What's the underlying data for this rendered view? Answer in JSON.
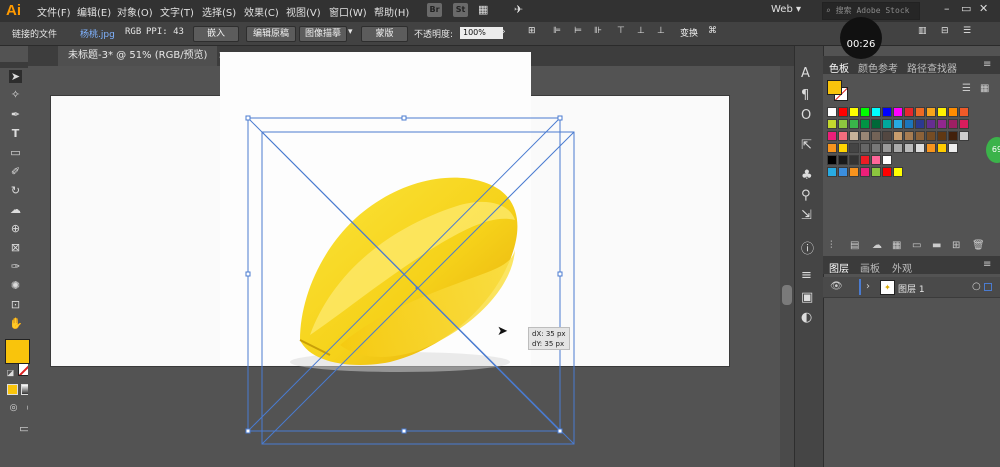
{
  "app": {
    "logo": "Ai",
    "menus": [
      "文件(F)",
      "编辑(E)",
      "对象(O)",
      "文字(T)",
      "选择(S)",
      "效果(C)",
      "视图(V)",
      "窗口(W)",
      "帮助(H)"
    ],
    "bridge_icon": "Br",
    "stock_icon": "St",
    "workspace": "Web",
    "stock_search_placeholder": "搜索 Adobe Stock",
    "timer": "00:26"
  },
  "control_bar": {
    "linked_file": "链接的文件",
    "file_name": "杨桃.jpg",
    "color_mode": "RGB",
    "ppi": "PPI: 43",
    "embed": "嵌入",
    "edit_original": "编辑原稿",
    "image_trace": "图像描摹",
    "mask": "蒙版",
    "opacity_label": "不透明度:",
    "opacity_value": "100%",
    "transform": "变换"
  },
  "document": {
    "tab_title": "未标题-3* @ 51% (RGB/预览)",
    "close": "×"
  },
  "canvas": {
    "dx": "dX: 35 px",
    "dy": "dY: 35 px"
  },
  "swatches_panel": {
    "tabs": [
      "色板",
      "颜色参考",
      "路径查找器"
    ],
    "active_tab": "色板"
  },
  "layers_panel": {
    "tabs": [
      "图层",
      "画板",
      "外观"
    ],
    "layer_name": "图层 1"
  },
  "badge": "69",
  "colors": {
    "fill": "#f9c40c",
    "fruit": "#f6d21a",
    "selection": "#4a7bd0",
    "accent": "#ff9a00"
  }
}
